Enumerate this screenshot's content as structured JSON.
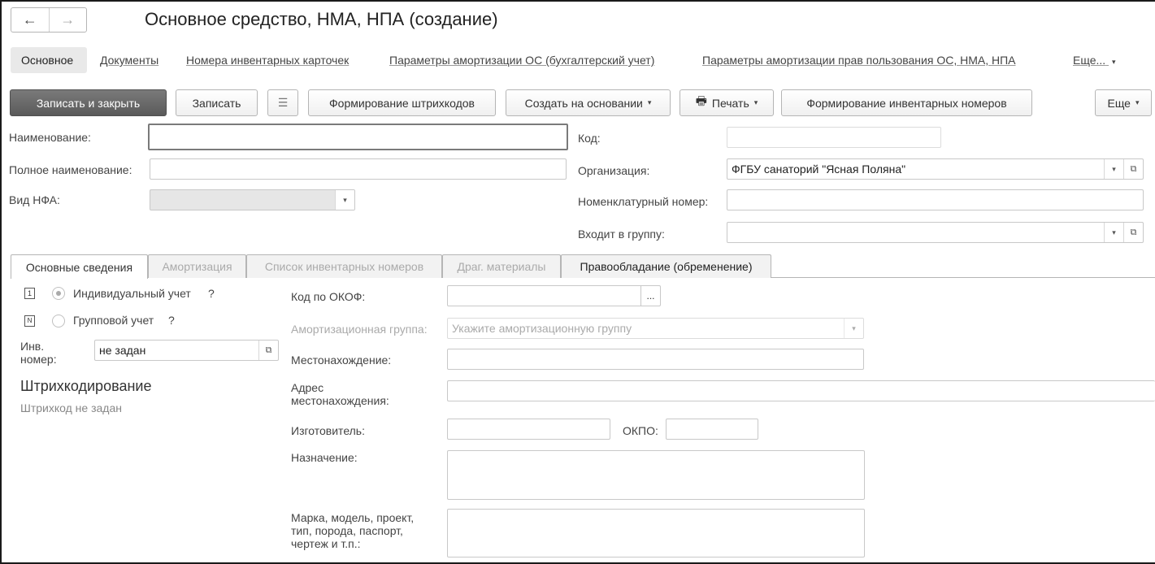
{
  "window": {
    "title": "Основное средство, НМА, НПА (создание)",
    "nav_back": "←",
    "nav_forward": "→"
  },
  "sections": [
    {
      "label": "Основное"
    },
    {
      "label": "Документы"
    },
    {
      "label": "Номера инвентарных карточек"
    },
    {
      "label": "Параметры амортизации ОС (бухгалтерский учет)"
    },
    {
      "label": "Параметры амортизации прав пользования ОС, НМА, НПА"
    },
    {
      "label": "Еще..."
    }
  ],
  "toolbar": {
    "save_close": "Записать и закрыть",
    "save": "Записать",
    "barcodes": "Формирование штрихкодов",
    "create_based": "Создать на основании",
    "print": "Печать",
    "inv_numbers": "Формирование инвентарных номеров",
    "more": "Еще"
  },
  "form": {
    "name_label": "Наименование:",
    "name_value": "",
    "fullname_label": "Полное наименование:",
    "fullname_value": "",
    "nfa_label": "Вид НФА:",
    "nfa_value": "",
    "code_label": "Код:",
    "code_value": "",
    "org_label": "Организация:",
    "org_value": "ФГБУ санаторий \"Ясная Поляна\"",
    "nomen_label": "Номенклатурный номер:",
    "nomen_value": "",
    "group_label": "Входит в группу:",
    "group_value": ""
  },
  "tabs": [
    {
      "label": "Основные сведения"
    },
    {
      "label": "Амортизация"
    },
    {
      "label": "Список инвентарных номеров"
    },
    {
      "label": "Драг. материалы"
    },
    {
      "label": "Правообладание (обременение)"
    }
  ],
  "details": {
    "individual_label": "Индивидуальный учет",
    "group_acct_label": "Групповой учет",
    "help_mark": "?",
    "inv_label_1": "Инв.",
    "inv_label_2": "номер:",
    "inv_value": "не задан",
    "barcode_heading": "Штрихкодирование",
    "barcode_note": "Штрихкод не задан",
    "okof_label": "Код по ОКОФ:",
    "okof_value": "",
    "amort_group_label": "Амортизационная группа:",
    "amort_group_placeholder": "Укажите амортизационную группу",
    "location_label": "Местонахождение:",
    "location_value": "",
    "address_label_1": "Адрес",
    "address_label_2": "местонахождения:",
    "address_value": "",
    "maker_label": "Изготовитель:",
    "maker_value": "",
    "okpo_label": "ОКПО:",
    "okpo_value": "",
    "purpose_label": "Назначение:",
    "purpose_value": "",
    "brand_label_1": "Марка, модель, проект,",
    "brand_label_2": "тип, порода, паспорт,",
    "brand_label_3": "чертеж и т.п.:",
    "brand_value": ""
  },
  "icons": {
    "dropdown": "▾",
    "open": "⧉",
    "ellipsis": "...",
    "print": "🖶",
    "list": "☰"
  }
}
